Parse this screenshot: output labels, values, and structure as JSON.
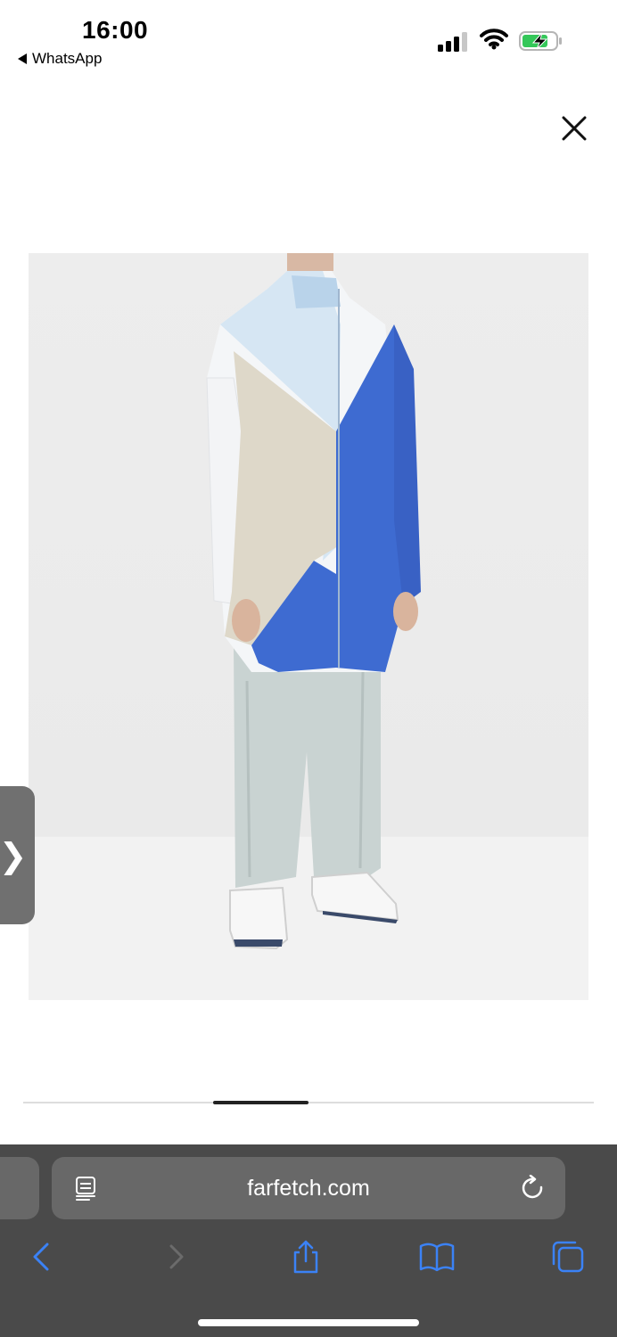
{
  "status_bar": {
    "time": "16:00",
    "back_app": "WhatsApp"
  },
  "browser": {
    "url": "farfetch.com"
  },
  "icons": {
    "close": "close-icon",
    "side_tab": "chevron-right-icon",
    "reader": "reader-mode-icon",
    "reload": "reload-icon",
    "back": "chevron-left-icon",
    "forward": "chevron-right-icon",
    "share": "share-icon",
    "bookmarks": "book-icon",
    "tabs": "tabs-icon"
  },
  "side_tab_glyph": "❯",
  "colors": {
    "toolbar_bg": "#4a4a4a",
    "url_bar_bg": "#686868",
    "ios_blue": "#3b82f6",
    "battery_green": "#34c759"
  }
}
